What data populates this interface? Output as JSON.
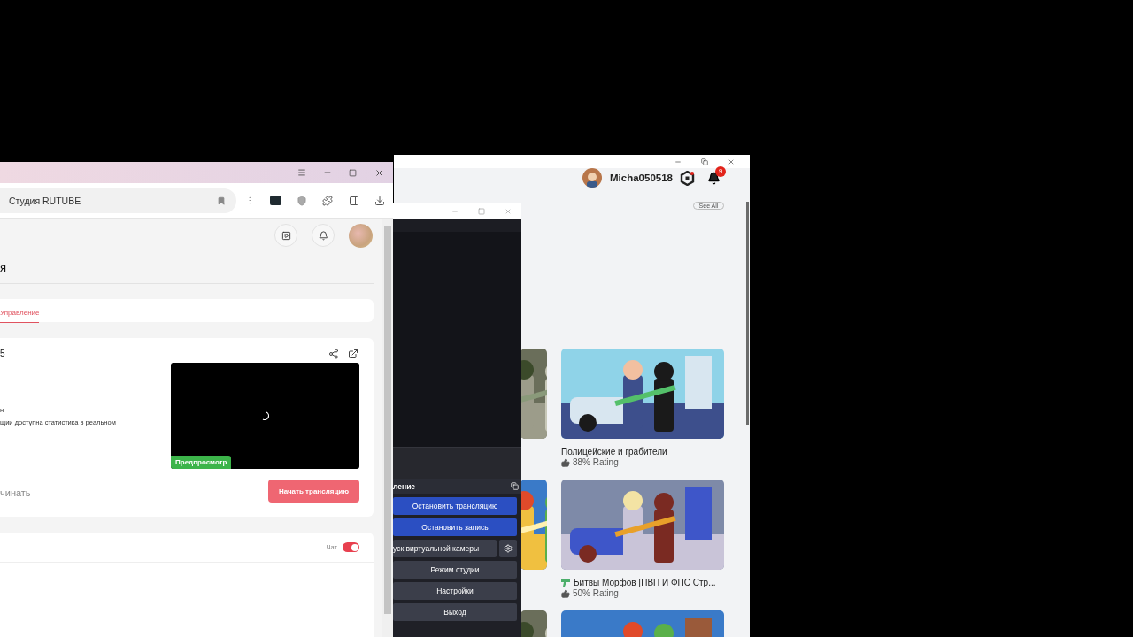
{
  "browser": {
    "address": "Студия RUTUBE",
    "page": {
      "heading": "я",
      "tabs": [
        {
          "label": "Управление",
          "selected": true
        }
      ],
      "stream": {
        "title": "5",
        "lines": [
          "н",
          "щии доступна статистика в реальном"
        ],
        "preview_badge": "Предпросмотр",
        "note": "чинать",
        "start_button": "Начать трансляцию"
      },
      "chat": {
        "label": "Чат",
        "on": true
      }
    }
  },
  "obs": {
    "dock_title": "ление",
    "buttons": [
      {
        "label": "Остановить трансляцию",
        "kind": "active"
      },
      {
        "label": "Остановить запись",
        "kind": "active"
      },
      {
        "label": "уск виртуальной камеры",
        "kind": "with_settings"
      },
      {
        "label": "Режим студии",
        "kind": "plain"
      },
      {
        "label": "Настройки",
        "kind": "plain"
      },
      {
        "label": "Выход",
        "kind": "plain"
      }
    ]
  },
  "roblox": {
    "username": "Micha050518",
    "notification_count": "9",
    "see_all": "See All",
    "games": [
      {
        "title": "Полицейские и грабители",
        "rating": "88% Rating",
        "has_icon": false
      },
      {
        "title": "Битвы Морфов [ПВП И ФПС Стр...",
        "rating": "50% Rating",
        "has_icon": true
      }
    ]
  }
}
